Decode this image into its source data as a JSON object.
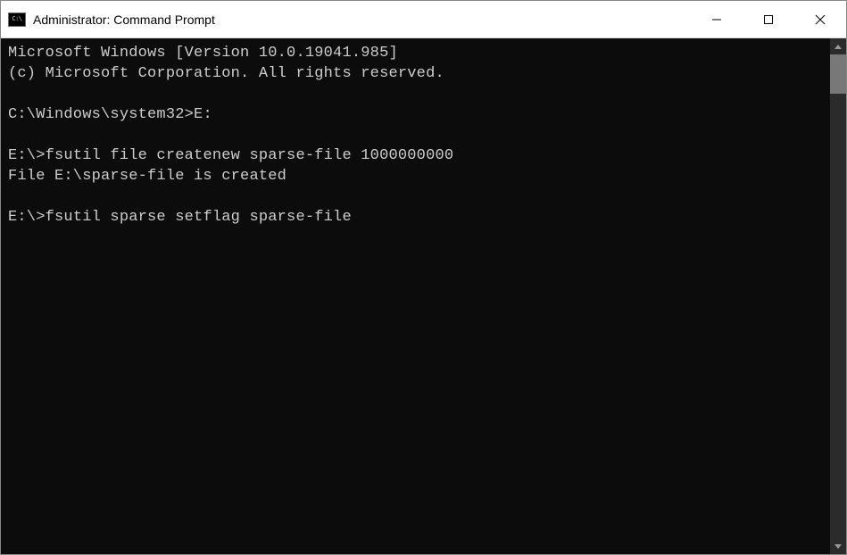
{
  "titlebar": {
    "icon_text": "C:\\",
    "title": "Administrator: Command Prompt"
  },
  "terminal": {
    "lines": {
      "l0": "Microsoft Windows [Version 10.0.19041.985]",
      "l1": "(c) Microsoft Corporation. All rights reserved.",
      "l2": "",
      "l3_prompt": "C:\\Windows\\system32>",
      "l3_cmd": "E:",
      "l4": "",
      "l5_prompt": "E:\\>",
      "l5_cmd": "fsutil file createnew sparse-file 1000000000",
      "l6": "File E:\\sparse-file is created",
      "l7": "",
      "l8_prompt": "E:\\>",
      "l8_cmd": "fsutil sparse setflag sparse-file"
    }
  }
}
